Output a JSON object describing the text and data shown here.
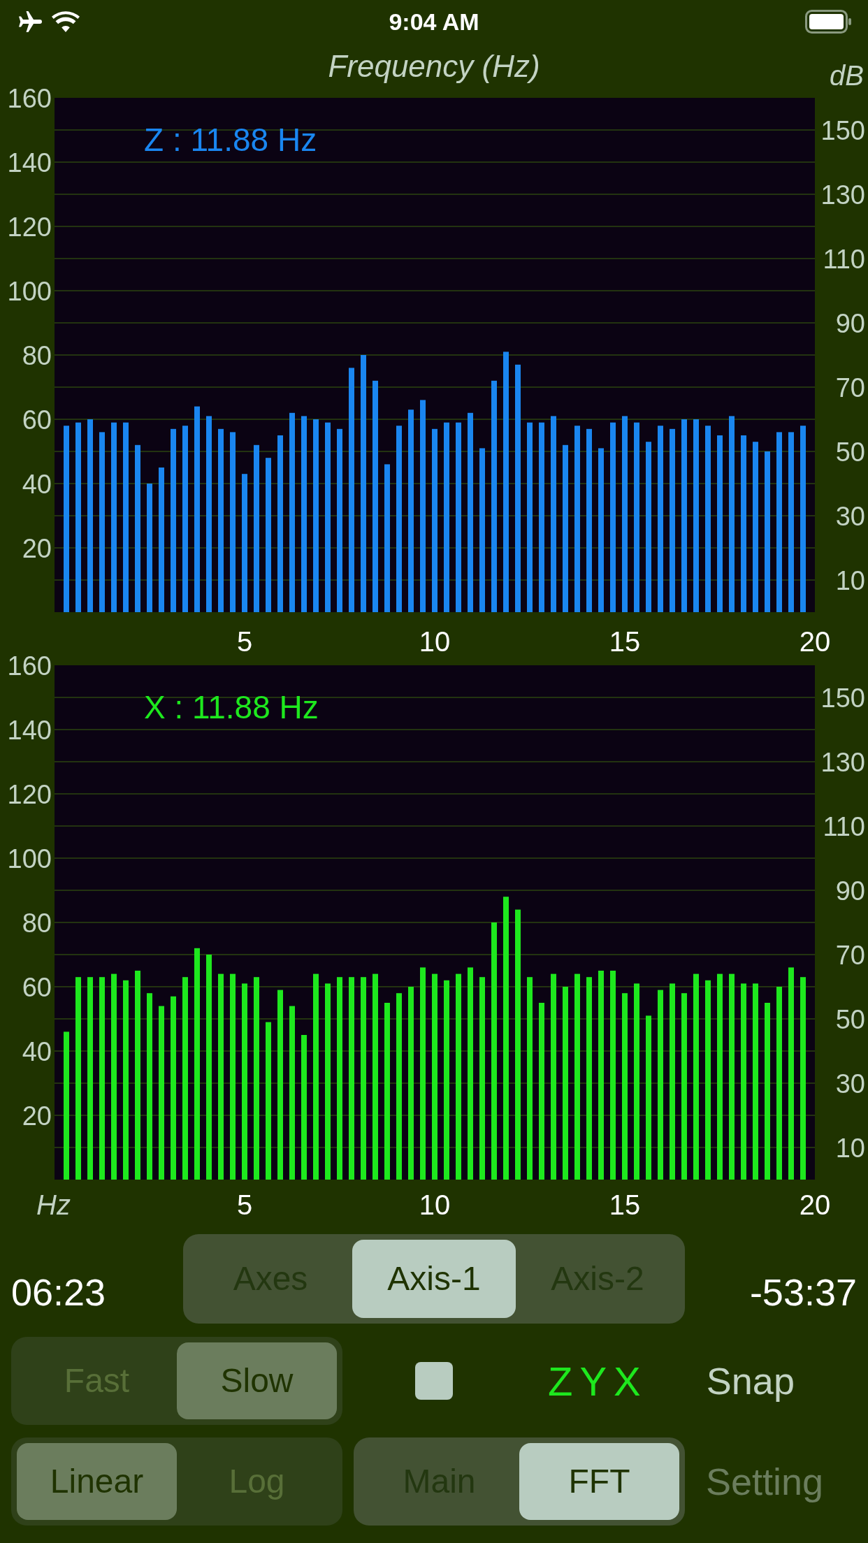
{
  "status_bar": {
    "time": "9:04 AM"
  },
  "title": "Frequency (Hz)",
  "right_axis_label": "dB",
  "charts": [
    {
      "kind": "top",
      "label": "Z : 11.88 Hz",
      "right_ticks": [
        "150",
        "130",
        "110",
        "90",
        "70",
        "50",
        "30",
        "10"
      ],
      "chart_data": {
        "type": "bar",
        "x": [
          0.3125,
          0.625,
          0.9375,
          1.25,
          1.5625,
          1.875,
          2.1875,
          2.5,
          2.8125,
          3.125,
          3.4375,
          3.75,
          4.0625,
          4.375,
          4.6875,
          5,
          5.3125,
          5.625,
          5.9375,
          6.25,
          6.5625,
          6.875,
          7.1875,
          7.5,
          7.8125,
          8.125,
          8.4375,
          8.75,
          9.0625,
          9.375,
          9.6875,
          10,
          10.3125,
          10.625,
          10.9375,
          11.25,
          11.5625,
          11.875,
          12.1875,
          12.5,
          12.8125,
          13.125,
          13.4375,
          13.75,
          14.0625,
          14.375,
          14.6875,
          15,
          15.3125,
          15.625,
          15.9375,
          16.25,
          16.5625,
          16.875,
          17.1875,
          17.5,
          17.8125,
          18.125,
          18.4375,
          18.75,
          19.0625,
          19.375,
          19.6875
        ],
        "grid": true,
        "series": [
          {
            "color": "#1a86f0",
            "values": [
              58,
              59,
              60,
              56,
              59,
              59,
              52,
              40,
              45,
              57,
              58,
              64,
              61,
              57,
              56,
              43,
              52,
              48,
              55,
              62,
              61,
              60,
              59,
              57,
              76,
              80,
              72,
              46,
              58,
              63,
              66,
              57,
              59,
              59,
              62,
              51,
              72,
              81,
              77,
              59,
              59,
              61,
              52,
              58,
              57,
              51,
              59,
              61,
              59,
              53,
              58,
              57,
              60,
              60,
              58,
              55,
              61,
              55,
              53,
              50,
              56,
              56,
              58
            ]
          }
        ],
        "xlim": [
          0,
          20
        ],
        "ylim": [
          0,
          160
        ],
        "xticks": [
          5,
          10,
          15,
          20
        ],
        "yticks": [
          20,
          40,
          60,
          80,
          100,
          120,
          140,
          160
        ]
      }
    },
    {
      "kind": "bottom",
      "label": "X : 11.88 Hz",
      "x_unit_label": "Hz",
      "right_ticks": [
        "150",
        "130",
        "110",
        "90",
        "70",
        "50",
        "30",
        "10"
      ],
      "chart_data": {
        "type": "bar",
        "x": [
          0.3125,
          0.625,
          0.9375,
          1.25,
          1.5625,
          1.875,
          2.1875,
          2.5,
          2.8125,
          3.125,
          3.4375,
          3.75,
          4.0625,
          4.375,
          4.6875,
          5,
          5.3125,
          5.625,
          5.9375,
          6.25,
          6.5625,
          6.875,
          7.1875,
          7.5,
          7.8125,
          8.125,
          8.4375,
          8.75,
          9.0625,
          9.375,
          9.6875,
          10,
          10.3125,
          10.625,
          10.9375,
          11.25,
          11.5625,
          11.875,
          12.1875,
          12.5,
          12.8125,
          13.125,
          13.4375,
          13.75,
          14.0625,
          14.375,
          14.6875,
          15,
          15.3125,
          15.625,
          15.9375,
          16.25,
          16.5625,
          16.875,
          17.1875,
          17.5,
          17.8125,
          18.125,
          18.4375,
          18.75,
          19.0625,
          19.375,
          19.6875
        ],
        "grid": true,
        "series": [
          {
            "color": "#1ee81e",
            "values": [
              46,
              63,
              63,
              63,
              64,
              62,
              65,
              58,
              54,
              57,
              63,
              72,
              70,
              64,
              64,
              61,
              63,
              49,
              59,
              54,
              45,
              64,
              61,
              63,
              63,
              63,
              64,
              55,
              58,
              60,
              66,
              64,
              62,
              64,
              66,
              63,
              80,
              88,
              84,
              63,
              55,
              64,
              60,
              64,
              63,
              65,
              65,
              58,
              61,
              51,
              59,
              61,
              58,
              64,
              62,
              64,
              64,
              61,
              61,
              55,
              60,
              66,
              63
            ]
          }
        ],
        "xlim": [
          0,
          20
        ],
        "ylim": [
          0,
          160
        ],
        "xticks": [
          5,
          10,
          15,
          20
        ],
        "yticks": [
          20,
          40,
          60,
          80,
          100,
          120,
          140,
          160
        ]
      }
    }
  ],
  "controls": {
    "time_left": "06:23",
    "time_right": "-53:37",
    "axis_mode": {
      "options": [
        {
          "label": "Axes",
          "selected": false
        },
        {
          "label": "Axis-1",
          "selected": true
        },
        {
          "label": "Axis-2",
          "selected": false
        }
      ]
    },
    "speed": {
      "options": [
        {
          "label": "Fast",
          "selected": false
        },
        {
          "label": "Slow",
          "selected": true
        }
      ]
    },
    "zyx_label": "ZYX",
    "snap": "Snap",
    "scale": {
      "options": [
        {
          "label": "Linear",
          "selected": true
        },
        {
          "label": "Log",
          "selected": false
        }
      ]
    },
    "view": {
      "options": [
        {
          "label": "Main",
          "selected": false
        },
        {
          "label": "FFT",
          "selected": true
        }
      ]
    },
    "setting": "Setting"
  }
}
